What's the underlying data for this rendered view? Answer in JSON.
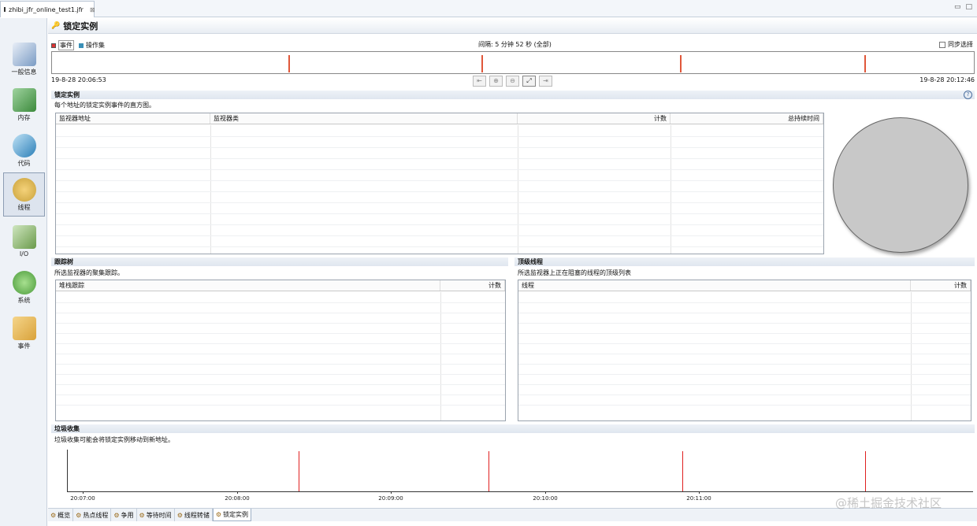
{
  "editor_tab": {
    "title": "zhibi_jfr_online_test1.jfr",
    "close": "⊠"
  },
  "window_controls": [
    "▭",
    "□"
  ],
  "sidebar": {
    "items": [
      {
        "label": "一般信息",
        "icon": "gauge-icon",
        "color": "#7a9bc4"
      },
      {
        "label": "内存",
        "icon": "memory-chip-icon",
        "color": "#3c8a3c"
      },
      {
        "label": "代码",
        "icon": "code-icon",
        "color": "#2c7fb8"
      },
      {
        "label": "线程",
        "icon": "threads-gear-icon",
        "color": "#c9a13a"
      },
      {
        "label": "I/O",
        "icon": "io-icon",
        "color": "#6a9a4a"
      },
      {
        "label": "系统",
        "icon": "system-icon",
        "color": "#4a9a3a"
      },
      {
        "label": "事件",
        "icon": "events-box-icon",
        "color": "#d9a23a"
      }
    ],
    "active_index": 3
  },
  "page": {
    "title": "锁定实例"
  },
  "timeline": {
    "legend_events": "事件",
    "legend_operation": "操作集",
    "interval": "间隔: 5 分钟 52 秒 (全部)",
    "sync_select": "同步选择",
    "start_time": "19-8-28 20:06:53",
    "end_time": "19-8-28 20:12:46",
    "event_positions": [
      0.256,
      0.465,
      0.68,
      0.88
    ],
    "event_color": "#e0573a",
    "zoom_buttons": [
      "⇤",
      "⊕",
      "⊖",
      "⤢",
      "⇥"
    ]
  },
  "lock_instances": {
    "title": "锁定实例",
    "description": "每个地址的锁定实例事件的直方图。",
    "columns": [
      "监视器地址",
      "监视器类",
      "计数",
      "总持续时间"
    ]
  },
  "trace_tree": {
    "title": "跟踪树",
    "description": "所选监视器的聚集跟踪。",
    "columns": [
      "堆栈跟踪",
      "计数"
    ]
  },
  "top_threads": {
    "title": "顶级线程",
    "description": "所选监视器上正在阻塞的线程的顶级列表",
    "columns": [
      "线程",
      "计数"
    ]
  },
  "gc": {
    "title": "垃圾收集",
    "description": "垃圾收集可能会将锁定实例移动到新地址。",
    "ticks": [
      "20:07:00",
      "20:08:00",
      "20:09:00",
      "20:10:00",
      "20:11:00"
    ],
    "marks_color": "#e02020"
  },
  "bottom_tabs": [
    {
      "label": "概览",
      "icon": "overview-icon"
    },
    {
      "label": "热点线程",
      "icon": "hot-threads-icon"
    },
    {
      "label": "争用",
      "icon": "contention-icon"
    },
    {
      "label": "等待时间",
      "icon": "wait-time-icon"
    },
    {
      "label": "线程转储",
      "icon": "thread-dump-icon"
    },
    {
      "label": "锁定实例",
      "icon": "lock-instances-icon"
    }
  ],
  "bottom_active_index": 5,
  "watermark": "@稀土掘金技术社区",
  "help": "?"
}
